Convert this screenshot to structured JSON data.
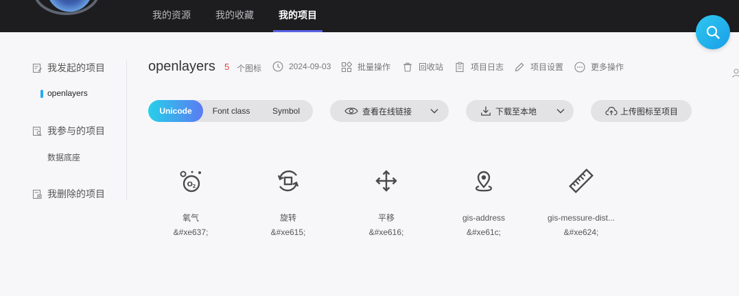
{
  "topbar": {
    "nav": [
      {
        "label": "我的资源"
      },
      {
        "label": "我的收藏"
      },
      {
        "label": "我的项目"
      }
    ],
    "active_index": 2,
    "search_icon": "search-icon",
    "accent": "#5b63e6"
  },
  "sidebar": {
    "group_initiated": {
      "label": "我发起的项目",
      "icon": "edit-doc-icon"
    },
    "initiated_items": [
      {
        "label": "openlayers"
      }
    ],
    "group_joined": {
      "label": "我参与的项目",
      "icon": "search-doc-icon"
    },
    "joined_items": [
      {
        "label": "数据底座"
      }
    ],
    "group_deleted": {
      "label": "我删除的项目",
      "icon": "delete-doc-icon"
    },
    "active_marker_color": "#29a9f0"
  },
  "project": {
    "title": "openlayers",
    "count": "5",
    "count_unit": "个图标",
    "date": "2024-09-03",
    "actions": {
      "batch": "批量操作",
      "recycle": "回收站",
      "log": "项目日志",
      "settings": "项目设置",
      "more": "更多操作"
    }
  },
  "toolbar": {
    "formats": [
      {
        "label": "Unicode"
      },
      {
        "label": "Font class"
      },
      {
        "label": "Symbol"
      }
    ],
    "active_format": 0,
    "view_online": "查看在线链接",
    "download": "下载至本地",
    "upload": "上传图标至项目"
  },
  "icons": [
    {
      "name": "氧气",
      "code": "&#xe637;",
      "glyph": "oxygen-icon"
    },
    {
      "name": "旋转",
      "code": "&#xe615;",
      "glyph": "rotate-icon"
    },
    {
      "name": "平移",
      "code": "&#xe616;",
      "glyph": "pan-move-icon"
    },
    {
      "name": "gis-address",
      "code": "&#xe61c;",
      "glyph": "location-pin-icon"
    },
    {
      "name": "gis-messure-dist...",
      "code": "&#xe624;",
      "glyph": "ruler-icon"
    }
  ]
}
